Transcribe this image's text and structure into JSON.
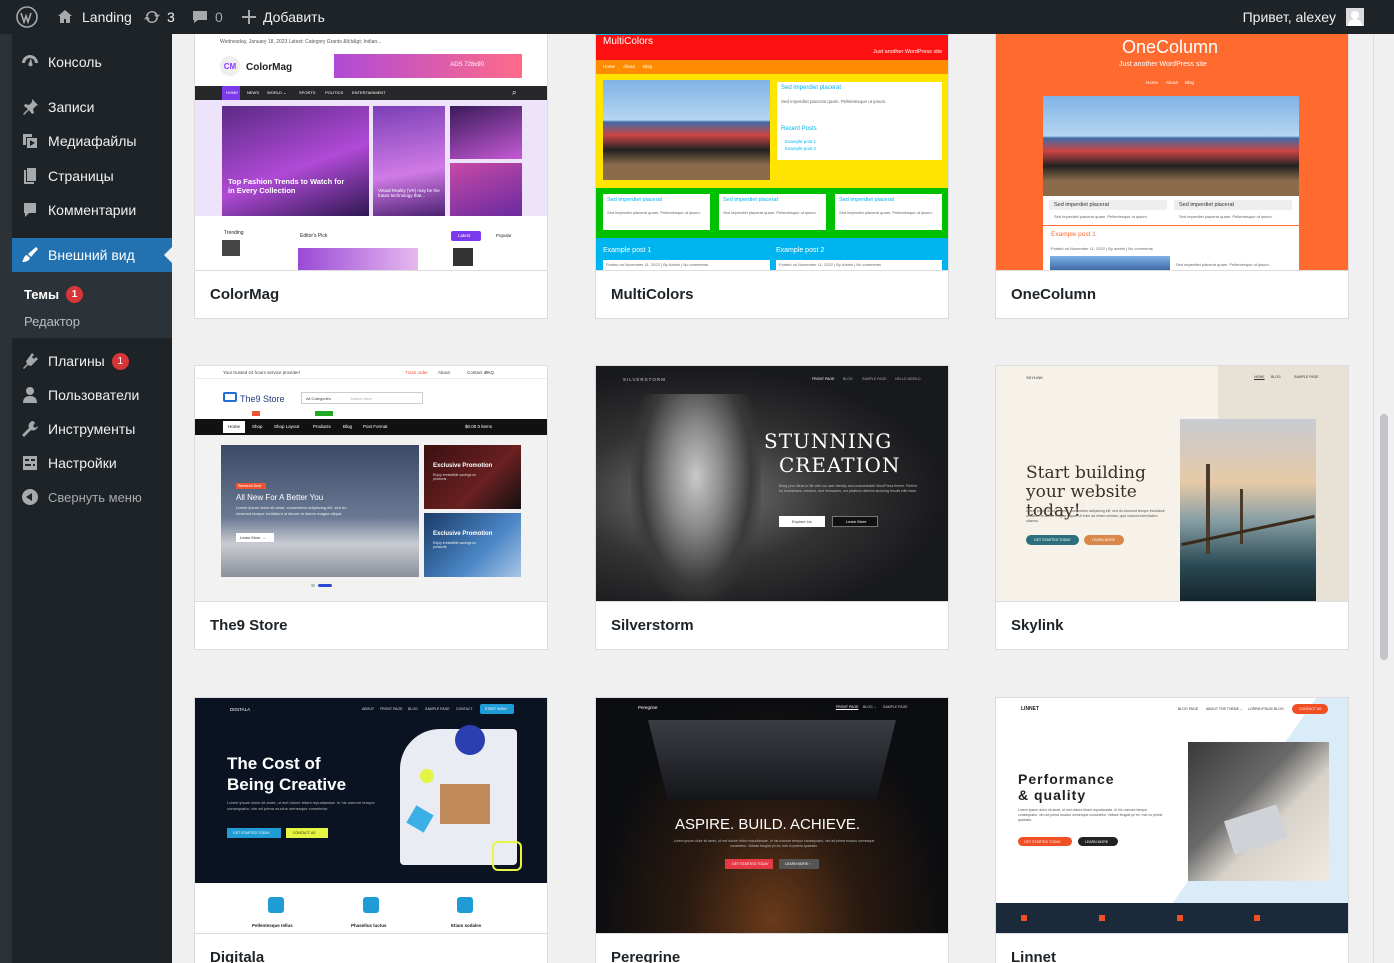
{
  "adminbar": {
    "site": "Landing",
    "updates": "3",
    "comments": "0",
    "new_label": "Добавить",
    "greeting": "Привет, alexey"
  },
  "sidebar": {
    "items": [
      {
        "label": "Консоль",
        "icon": "dashboard-icon"
      },
      {
        "label": "Записи",
        "icon": "pin-icon"
      },
      {
        "label": "Медиафайлы",
        "icon": "media-icon"
      },
      {
        "label": "Страницы",
        "icon": "page-icon"
      },
      {
        "label": "Комментарии",
        "icon": "comment-icon"
      },
      {
        "label": "Внешний вид",
        "icon": "brush-icon"
      },
      {
        "label": "Плагины",
        "icon": "plugin-icon",
        "badge": "1"
      },
      {
        "label": "Пользователи",
        "icon": "user-icon"
      },
      {
        "label": "Инструменты",
        "icon": "wrench-icon"
      },
      {
        "label": "Настройки",
        "icon": "settings-icon"
      },
      {
        "label": "Свернуть меню",
        "icon": "collapse-icon"
      }
    ],
    "submenu": {
      "themes": "Темы",
      "themes_badge": "1",
      "editor": "Редактор"
    }
  },
  "themes": [
    {
      "name": "ColorMag",
      "shot": {
        "top": "Wednesday, January 18, 2023   Latest: Category Grants &lt;b&gt; Indian...",
        "logo": "ColorMag",
        "ads": "ADS 728x90",
        "nav": [
          "HOME",
          "NEWS",
          "WORLD ⌄",
          "SPORTS",
          "POLITICS",
          "ENTERTAINMENT"
        ],
        "h1": "Top Fashion Trends to Watch for in Every Collection",
        "h2": "Virtual Reality (VR) may be the future technology that...",
        "trending": "Trending",
        "editors": "Editor's Pick",
        "latest": "Latest",
        "popular": "Popular"
      }
    },
    {
      "name": "MultiColors",
      "shot": {
        "title": "MultiColors",
        "tagline": "Just another WordPress site",
        "nav": [
          "Home",
          "About",
          "Blog"
        ],
        "w1": "Sed imperdiet placerat",
        "w1t": "Sed imperdiet placerat quam. Pellentesque ut ipsum.",
        "recent": "Recent Posts",
        "p1": "Example post 1",
        "p2": "Example post 2",
        "b1": "Sed imperdiet placerat",
        "b1t": "Sed imperdiet placerat quam. Pellentesque ut ipsum.",
        "e1": "Example post 1",
        "e2": "Example post 2",
        "meta": "Posted on November 11, 2022 | By Admin | No comments"
      }
    },
    {
      "name": "OneColumn",
      "shot": {
        "title": "OneColumn",
        "tagline": "Just another WordPress site",
        "nav": [
          "Home",
          "About",
          "Blog"
        ],
        "c1": "Sed imperdiet placerat",
        "c1t": "Sed imperdiet placerat quam. Pellentesque ut ipsum.",
        "c2": "Sed imperdiet placerat",
        "c2t": "Sed imperdiet placerat quam. Pellentesque ut ipsum.",
        "post": "Example post 1",
        "meta": "Posted on November 11, 2022 | By admin | No comments",
        "ft": "Sed imperdiet placerat quam. Pellentesque ut ipsum."
      }
    },
    {
      "name": "The9 Store",
      "shot": {
        "top": "Your trusted 24 hours service provider!",
        "links": [
          "Track order",
          "About",
          "Contact us",
          "FAQ"
        ],
        "logo": "The9 Store",
        "cat": "All Categories",
        "search": "Search here",
        "nav": [
          "Home",
          "Shop",
          "Shop Layout",
          "Products",
          "Blog",
          "Post Format"
        ],
        "cart": "$0.00  0 items",
        "tag": "Weekend Deal",
        "h1": "All New For A Better You",
        "body": "Lorem ipsum dolor sit amet, consectetur adipiscing elit, sed do eiusmod tempor incididunt ut labore et dolore magna aliqua.",
        "btn": "Learn More →",
        "promo1": "Exclusive Promotion",
        "promo2": "Exclusive Promotion",
        "ptext": "Enjoy irresistible savings on products"
      }
    },
    {
      "name": "Silverstorm",
      "shot": {
        "brand": "SILVERSTORM",
        "nav": [
          "FRONT PAGE",
          "BLOG",
          "SAMPLE PAGE",
          "HELLO WORLD"
        ],
        "h1": "STUNNING",
        "h2": "CREATION",
        "body": "Bring your ideas to life with our user friendly and customizable WordPress theme. Perfect for businesses, creators, and innovators, our platform delivers stunning results with ease.",
        "b1": "Explore Us",
        "b2": "Learn More"
      }
    },
    {
      "name": "Skylink",
      "shot": {
        "brand": "SKYLINK",
        "nav": [
          "HOME",
          "BLOG",
          "SAMPLE PAGE"
        ],
        "h1": "Start building your website today!",
        "body": "Lorem ipsum dolor sit amet, consectetur adipiscing elit, sed do eiusmod tempor incididunt ut labore et dolore magna aliqua. Ut enim ad minim veniam, quis nostrud exercitation ullamco.",
        "b1": "GET STARTED TODAY",
        "b2": "LEARN MORE"
      }
    },
    {
      "name": "Digitala",
      "shot": {
        "brand": "DIGITALA",
        "nav": [
          "ABOUT",
          "FRONT PAGE",
          "BLOG",
          "SAMPLE PAGE",
          "CONTACT"
        ],
        "cta": "START NOW!",
        "h1": "The Cost of",
        "h2": "Being Creative",
        "body": "Lorem ipsum dolor sit amet, ut mel dolore tritani repudiandae. In his nomore tempor consequatur, vim ad prima mucius omnesque consetetur.",
        "b1": "GET STARTED TODAY",
        "b2": "CONTACT US",
        "f1": "Pellentesque tellus",
        "f2": "Phasellus luctus",
        "f3": "Etiam sodales"
      }
    },
    {
      "name": "Peregrine",
      "shot": {
        "brand": "Peregrine",
        "nav": [
          "FRONT PAGE",
          "BLOG ⌄",
          "SAMPLE PAGE"
        ],
        "h1": "ASPIRE. BUILD. ACHIEVE.",
        "body": "Lorem ipsum dolor sit amet, ut mel dolore tritani repudiandae. In his nomore tempor consequatur, vim ad prima mucius omnesque consetetur. Vidisse feugiat pri ex, mei cu primis quaestio.",
        "b1": "GET STARTED TODAY",
        "b2": "LEARN MORE ›"
      }
    },
    {
      "name": "Linnet",
      "shot": {
        "brand": "LINNET",
        "nav": [
          "BLOG PAGE",
          "ABOUT THE THEME ⌄",
          "LOREM IPSUM",
          "BLOG"
        ],
        "cta": "CONTACT US",
        "h1": "Performance",
        "h2": "& quality",
        "body": "Lorem ipsum dolor sit amet, ut mel dolore tritani repudiandae. In his nomore tempor consequatur, vim ad prima mucius omnesque consetetur. Vidisse feugiat pri ex, mei cu primis quaestio.",
        "b1": "GET STARTED TODAY",
        "b2": "LEARN MORE"
      }
    }
  ]
}
